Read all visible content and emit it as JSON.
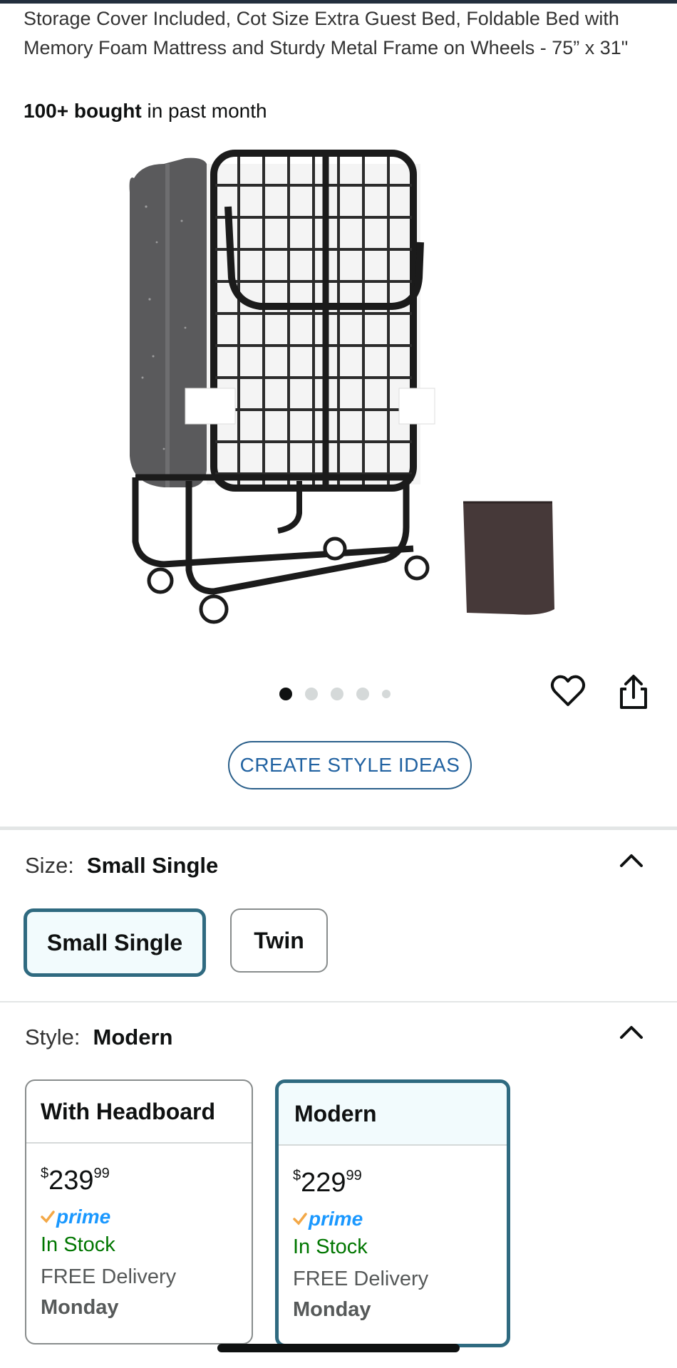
{
  "product": {
    "title": "Storage Cover Included, Cot Size Extra Guest Bed, Foldable Bed with Memory Foam Mattress and Sturdy Metal Frame on Wheels - 75” x 31\"",
    "bought_bold": "100+ bought",
    "bought_rest": " in past month"
  },
  "gallery": {
    "image_count": 5,
    "active_index": 0
  },
  "actions": {
    "style_ideas_label": "CREATE STYLE IDEAS",
    "icons": [
      "heart-icon",
      "share-icon"
    ]
  },
  "size": {
    "label": "Size:",
    "selected": "Small Single",
    "options": [
      "Small Single",
      "Twin"
    ]
  },
  "style": {
    "label": "Style:",
    "selected": "Modern",
    "options": [
      {
        "name": "With Headboard",
        "price_symbol": "$",
        "price_whole": "239",
        "price_fraction": "99",
        "prime": "prime",
        "stock": "In Stock",
        "delivery": "FREE Delivery",
        "day": "Monday"
      },
      {
        "name": "Modern",
        "price_symbol": "$",
        "price_whole": "229",
        "price_fraction": "99",
        "prime": "prime",
        "stock": "In Stock",
        "delivery": "FREE Delivery",
        "day": "Monday"
      }
    ]
  },
  "colors": {
    "selected_border": "#2f6a80",
    "prime_blue": "#1a98ff",
    "prime_check": "#f3a847",
    "in_stock": "#007600",
    "link_blue": "#2162a1"
  }
}
